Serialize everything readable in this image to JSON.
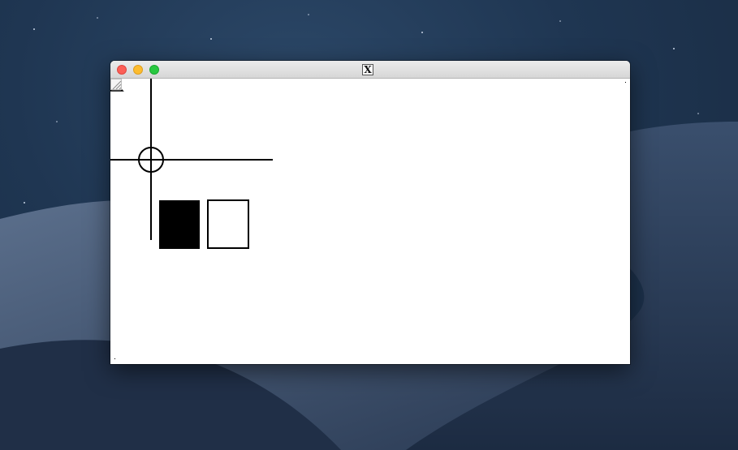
{
  "window": {
    "title_glyph": "X"
  },
  "icons": {
    "window_title": "x11-app-icon",
    "corner_marker": "corner-triangle-marker",
    "crosshair": "crosshair-icon",
    "filled_box": "filled-rectangle",
    "outlined_box": "outlined-rectangle",
    "resize": "resize-grip-icon"
  }
}
